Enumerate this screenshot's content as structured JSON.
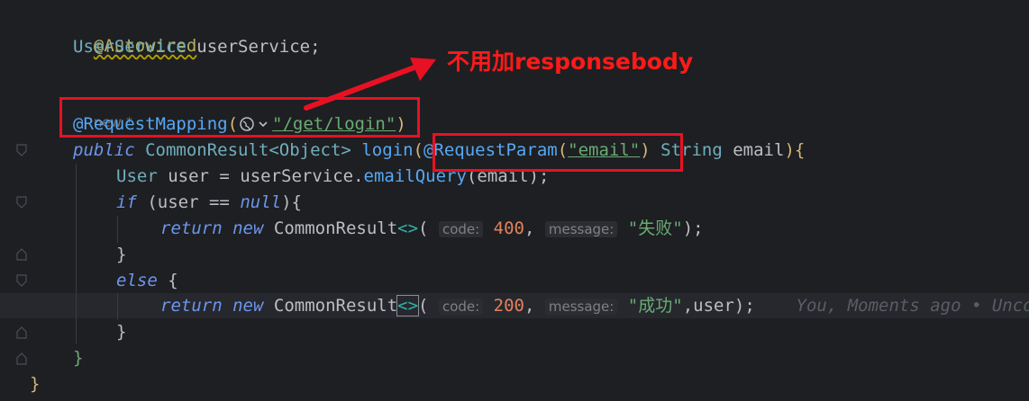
{
  "editor": {
    "lines": {
      "l1": {
        "ann": "@Autowired"
      },
      "l2": {
        "type": "UserService",
        "name": "userService",
        "semi": ";"
      },
      "l3": {
        "usage": "new *"
      },
      "l4": {
        "ann": "@RequestMapping",
        "open": "(",
        "path": "\"/get/login\"",
        "close": ")"
      },
      "l5": {
        "kw": "public",
        "ret": "CommonResult<Object>",
        "method": "login",
        "open": "(",
        "ann": "@RequestParam",
        "param_open": "(",
        "param_val": "\"email\"",
        "param_close": ")",
        "ptype": "String",
        "pname": "email",
        "end": "){"
      },
      "l6": {
        "type": "User",
        "text1": " user = userService.",
        "call": "emailQuery",
        "text2": "(email);"
      },
      "l7": {
        "kw": "if",
        "text1": " (user ",
        "op": "==",
        "kw2": "null",
        "text2": "){"
      },
      "l8": {
        "kw": "return",
        "kw2": "new",
        "cls": "CommonResult",
        "diamond": "<>",
        "open": "(",
        "hint_code": "code:",
        "code": "400",
        "comma": ",",
        "hint_msg": "message:",
        "msg": "\"失败\"",
        "end": ");"
      },
      "l9": {
        "brace": "}"
      },
      "l10": {
        "kw": "else",
        "brace": " {"
      },
      "l11": {
        "kw": "return",
        "kw2": "new",
        "cls": "CommonResult",
        "diamond": "<>",
        "open": "(",
        "hint_code": "code:",
        "code": "200",
        "comma": ",",
        "hint_msg": "message:",
        "msg": "\"成功\"",
        "end": ",user);",
        "blame": "You, Moments ago • Unco"
      },
      "l12": {
        "brace": "}"
      },
      "l13": {
        "brace": "}"
      },
      "l14": {
        "brace": "}"
      }
    }
  },
  "annotation": {
    "callout_text": "不用加responsebody",
    "color": "#ff1a1a"
  }
}
